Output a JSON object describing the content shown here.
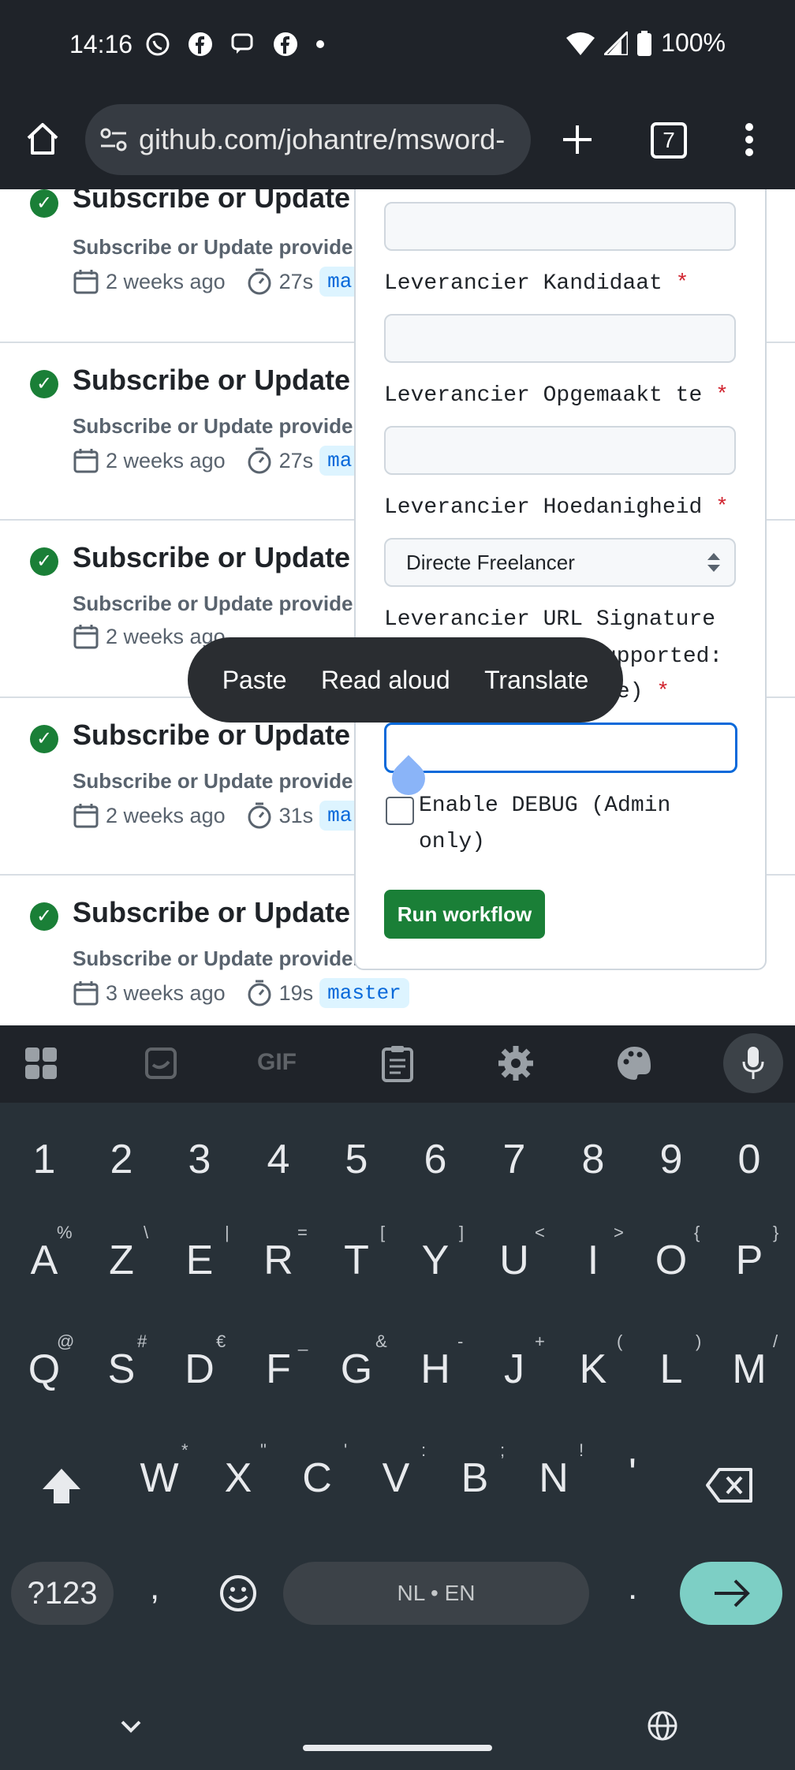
{
  "status_bar": {
    "time": "14:16",
    "battery": "100%"
  },
  "browser": {
    "url": "github.com/johantre/msword-",
    "tab_count": "7"
  },
  "runs": [
    {
      "title": "Subscribe or Update p",
      "subtitle": "Subscribe or Update provider",
      "age": "2 weeks ago",
      "duration": "27s",
      "branch": "ma"
    },
    {
      "title": "Subscribe or Update p",
      "subtitle": "Subscribe or Update provider",
      "age": "2 weeks ago",
      "duration": "27s",
      "branch": "ma"
    },
    {
      "title": "Subscribe or Update p",
      "subtitle": "Subscribe or Update provider",
      "age": "2 weeks ago",
      "duration": "",
      "branch": ""
    },
    {
      "title": "Subscribe or Update p",
      "subtitle": "Subscribe or Update provider",
      "age": "2 weeks ago",
      "duration": "31s",
      "branch": "ma"
    },
    {
      "title": "Subscribe or Update p",
      "subtitle": "Subscribe or Update provider",
      "age": "3 weeks ago",
      "duration": "19s",
      "branch": "master"
    }
  ],
  "form": {
    "label_kandidaat": "Leverancier Kandidaat",
    "label_opgemaakt": "Leverancier Opgemaakt te",
    "label_hoedanigheid": "Leverancier Hoedanigheid",
    "hoedanigheid_value": "Directe Freelancer",
    "label_url_line1": "Leverancier URL Signature",
    "label_url_line2": "upported:",
    "label_url_line3": "ve)",
    "required_mark": "*",
    "debug_line1": "Enable DEBUG (Admin",
    "debug_line2": "only)",
    "run_button": "Run workflow"
  },
  "context_menu": {
    "paste": "Paste",
    "read_aloud": "Read aloud",
    "translate": "Translate"
  },
  "keyboard": {
    "row_numbers": [
      "1",
      "2",
      "3",
      "4",
      "5",
      "6",
      "7",
      "8",
      "9",
      "0"
    ],
    "row1": [
      "A",
      "Z",
      "E",
      "R",
      "T",
      "Y",
      "U",
      "I",
      "O",
      "P"
    ],
    "row1_hints": [
      "%",
      "\\",
      "|",
      "=",
      "[",
      "]",
      "<",
      ">",
      "{",
      "}"
    ],
    "row2": [
      "Q",
      "S",
      "D",
      "F",
      "G",
      "H",
      "J",
      "K",
      "L",
      "M"
    ],
    "row2_hints": [
      "@",
      "#",
      "€",
      "_",
      "&",
      "-",
      "+",
      "(",
      ")",
      "/"
    ],
    "row3": [
      "W",
      "X",
      "C",
      "V",
      "B",
      "N",
      "'"
    ],
    "row3_hints": [
      "*",
      "\"",
      "'",
      ":",
      ";",
      "!",
      ""
    ],
    "symbols_key": "?123",
    "comma": ",",
    "space_label": "NL • EN",
    "period": "."
  },
  "colors": {
    "accent_green": "#1a7f37",
    "focus_blue": "#0969da",
    "enter_key": "#7dcfc5"
  }
}
